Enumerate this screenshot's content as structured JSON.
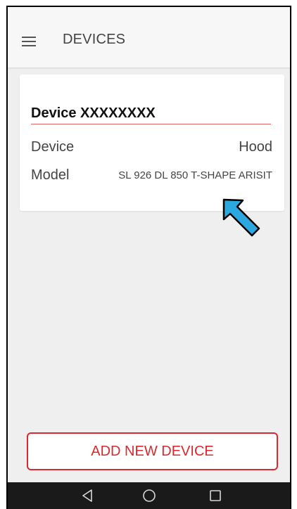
{
  "appbar": {
    "title": "DEVICES",
    "menu_icon": "hamburger-menu-icon"
  },
  "device_card": {
    "title": "Device XXXXXXXX",
    "rows": [
      {
        "label": "Device",
        "value": "Hood"
      },
      {
        "label": "Model",
        "value": "SL 926 DL 850 T-SHAPE ARISIT"
      }
    ]
  },
  "actions": {
    "add_device_label": "ADD NEW DEVICE"
  },
  "nav": {
    "back_icon": "back-triangle-icon",
    "home_icon": "home-circle-icon",
    "recents_icon": "recents-square-icon"
  },
  "colors": {
    "accent": "#d9282f",
    "annotation_arrow": "#2aa8df",
    "background": "#efefef",
    "card": "#ffffff",
    "nav_bar": "#1a1a1a"
  }
}
